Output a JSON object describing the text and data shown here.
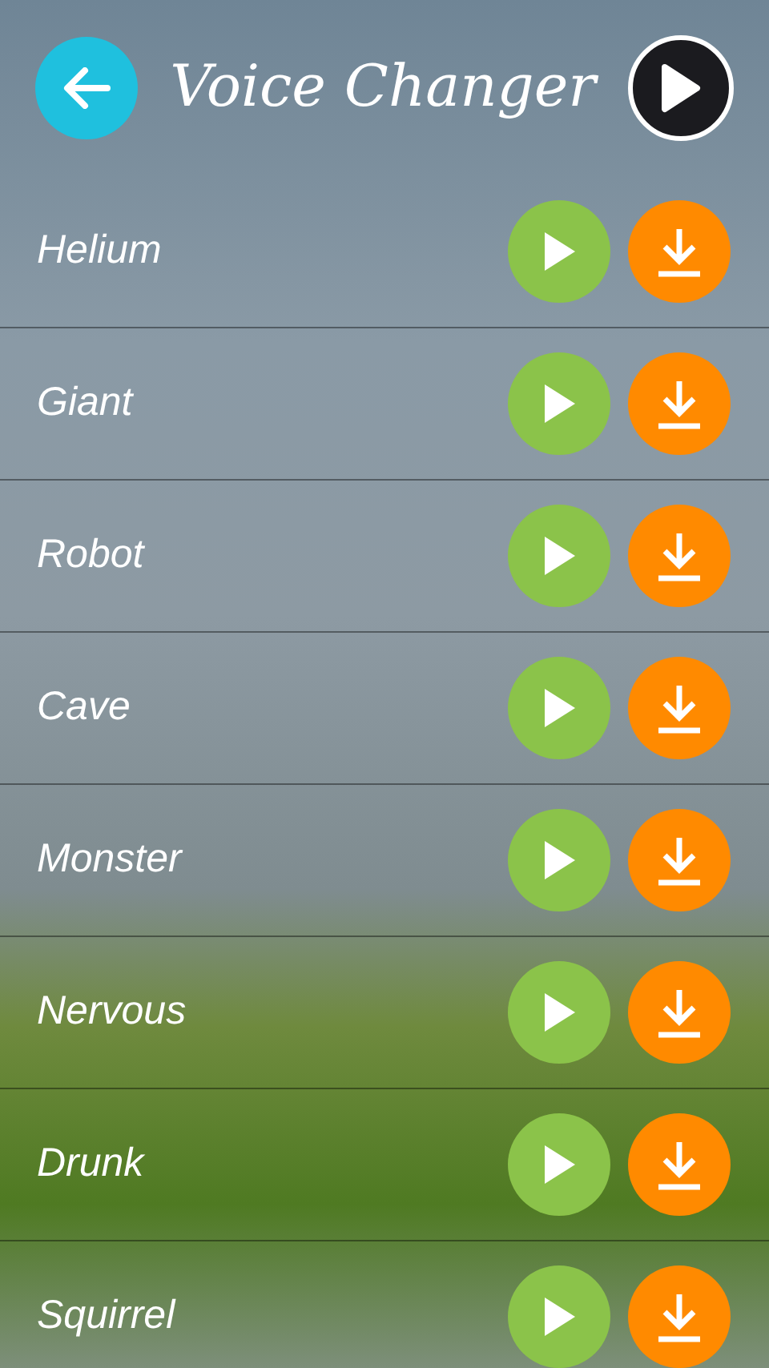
{
  "header": {
    "title": "Voice Changer"
  },
  "effects": [
    {
      "name": "Helium"
    },
    {
      "name": "Giant"
    },
    {
      "name": "Robot"
    },
    {
      "name": "Cave"
    },
    {
      "name": "Monster"
    },
    {
      "name": "Nervous"
    },
    {
      "name": "Drunk"
    },
    {
      "name": "Squirrel"
    }
  ]
}
